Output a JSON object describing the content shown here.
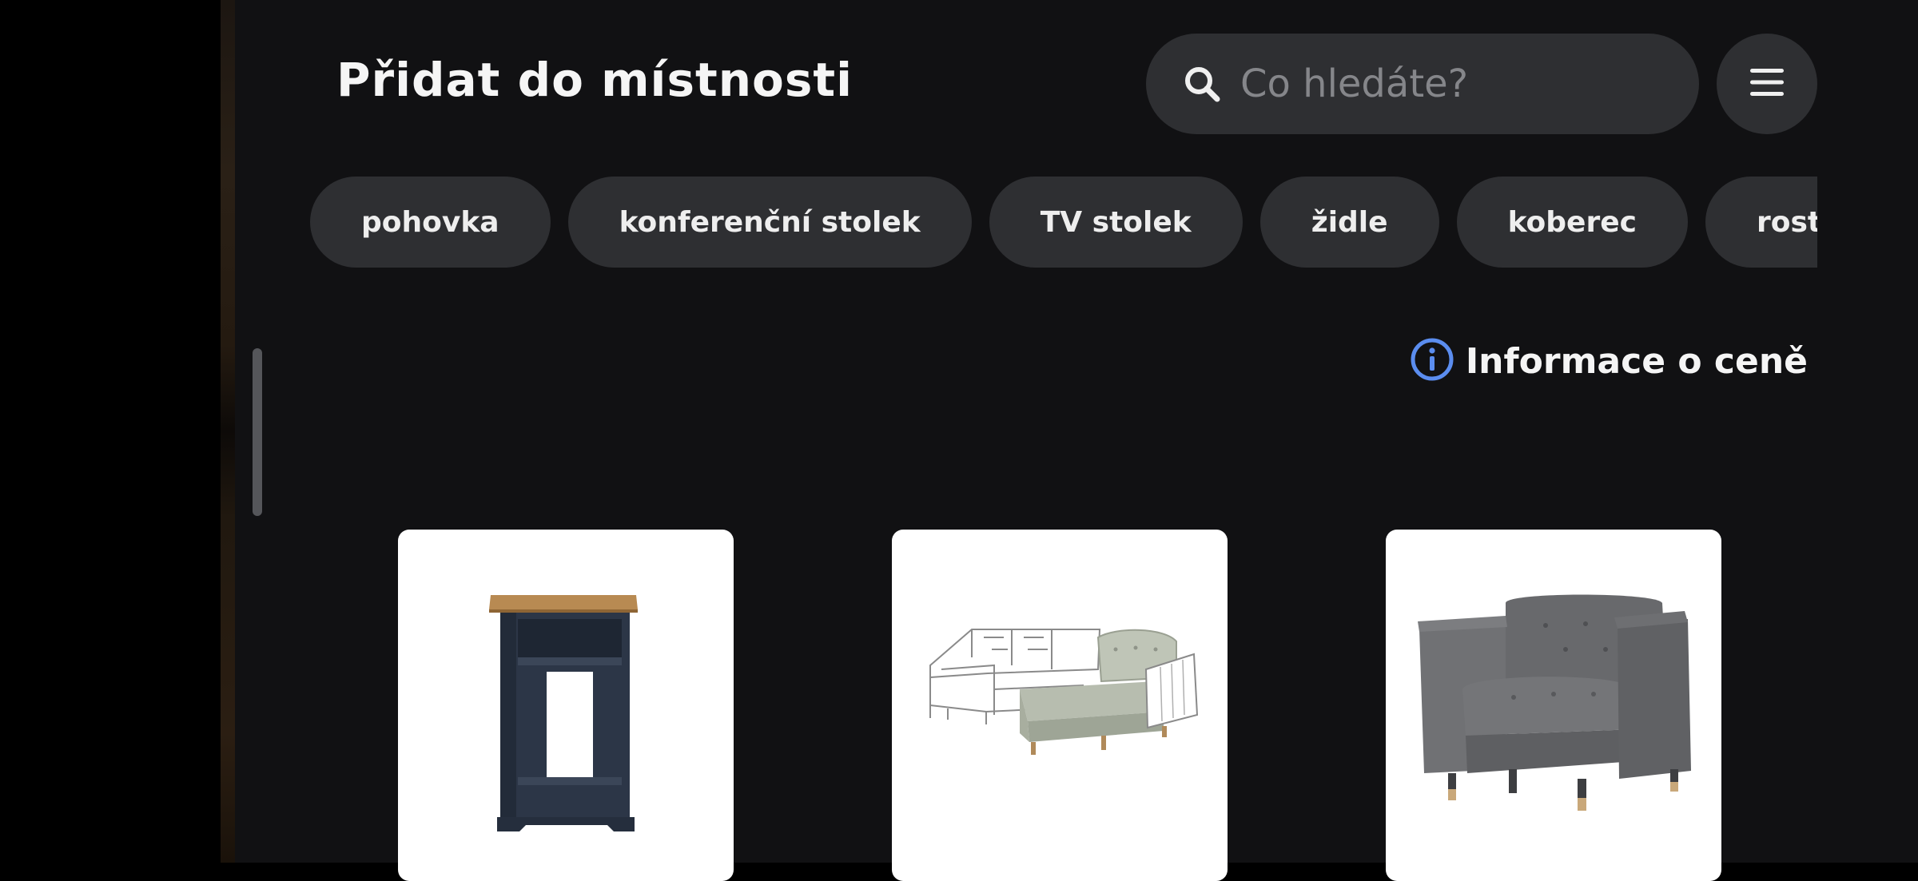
{
  "header": {
    "title": "Přidat do místnosti"
  },
  "search": {
    "placeholder": "Co hledáte?",
    "icon": "search-icon"
  },
  "menu": {
    "icon": "hamburger-menu-icon"
  },
  "categories": [
    {
      "label": "pohovka"
    },
    {
      "label": "konferenční stolek"
    },
    {
      "label": "TV stolek"
    },
    {
      "label": "židle"
    },
    {
      "label": "koberec"
    },
    {
      "label": "rostliny"
    }
  ],
  "price_info": {
    "label": "Informace o ceně",
    "icon": "info-icon",
    "accent_color": "#5b8def"
  },
  "products": [
    {
      "kind": "side-table",
      "icon": "nightstand-icon"
    },
    {
      "kind": "corner-sofa",
      "icon": "sofa-icon"
    },
    {
      "kind": "armchair",
      "icon": "armchair-icon"
    }
  ],
  "colors": {
    "background": "#111113",
    "surface": "#2e2f32",
    "text": "#f5f5f5",
    "placeholder": "#85868a"
  }
}
